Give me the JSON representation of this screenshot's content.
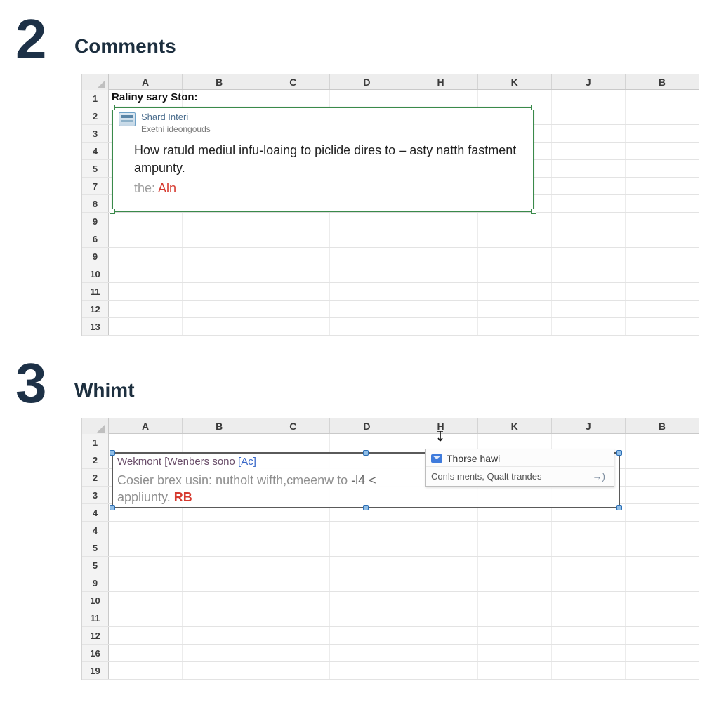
{
  "section2": {
    "number": "2",
    "title": "Comments",
    "columns": [
      "A",
      "B",
      "C",
      "D",
      "H",
      "K",
      "J",
      "B"
    ],
    "row_numbers": [
      "1",
      "2",
      "3",
      "4",
      "5",
      "7",
      "8",
      "9",
      "6",
      "9",
      "10",
      "11",
      "12",
      "13"
    ],
    "a1_text": "Raliny sary Ston:",
    "comment": {
      "author": "Shard Interi",
      "subline": "Exetni ideongouds",
      "body": "How ratuld mediul infu-loaing to piclide dires to – asty natth fastment ampunty.",
      "footer_prefix": "the: ",
      "footer_highlight": "Aln"
    }
  },
  "section3": {
    "number": "3",
    "title": "Whimt",
    "columns": [
      "A",
      "B",
      "C",
      "D",
      "H",
      "K",
      "J",
      "B"
    ],
    "row_numbers": [
      "1",
      "2",
      "2",
      "3",
      "4",
      "4",
      "5",
      "5",
      "9",
      "10",
      "11",
      "12",
      "16",
      "19"
    ],
    "selection": {
      "title_plain": "Wekmont [Wenbers sono ",
      "title_bracket": "[Ac]",
      "body_main": "Cosier brex usin: nutholt wifth,cmeenw to ",
      "body_carets": "-l4 <",
      "foot_plain": "appliunty. ",
      "foot_red": "RB"
    },
    "tooltip": {
      "line1": "Thorse hawi",
      "line2": "Conls ments, Qualt trandes",
      "arrow": "→)"
    }
  }
}
